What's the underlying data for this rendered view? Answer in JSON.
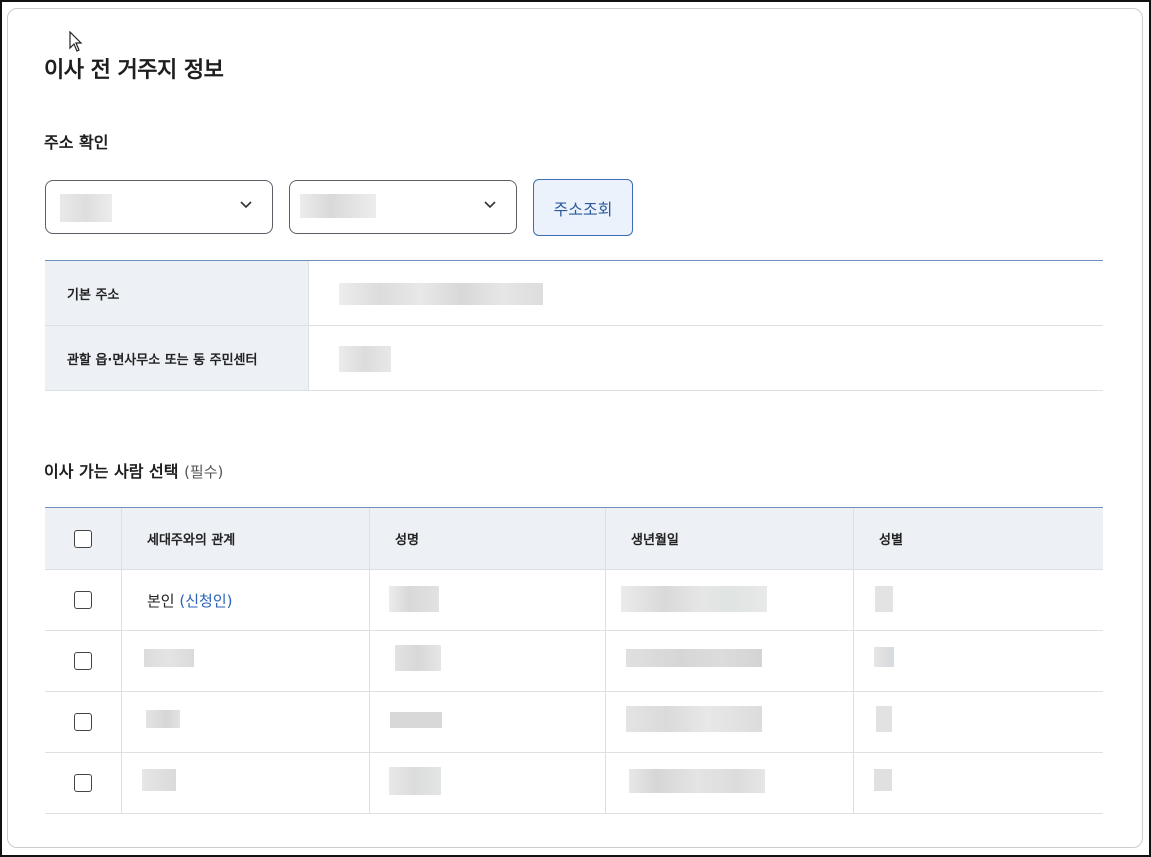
{
  "page": {
    "title": "이사 전 거주지 정보"
  },
  "address_section": {
    "heading": "주소 확인",
    "search_button": "주소조회",
    "rows": [
      {
        "label": "기본 주소"
      },
      {
        "label": "관할 읍·면사무소 또는 동 주민센터"
      }
    ]
  },
  "mover_section": {
    "heading": "이사 가는 사람 선택",
    "required": "(필수)",
    "columns": [
      "세대주와의 관계",
      "성명",
      "생년월일",
      "성별"
    ],
    "first_row": {
      "relation": "본인",
      "applicant_tag": "(신청인)"
    }
  },
  "icons": [
    "cursor-icon",
    "chevron-down-icon",
    "checkbox-icon"
  ],
  "colors": {
    "accent": "#2a5a9d",
    "header_bg": "#edf0f5",
    "table_top_border": "#6e8fb8",
    "link": "#2a62b8"
  }
}
